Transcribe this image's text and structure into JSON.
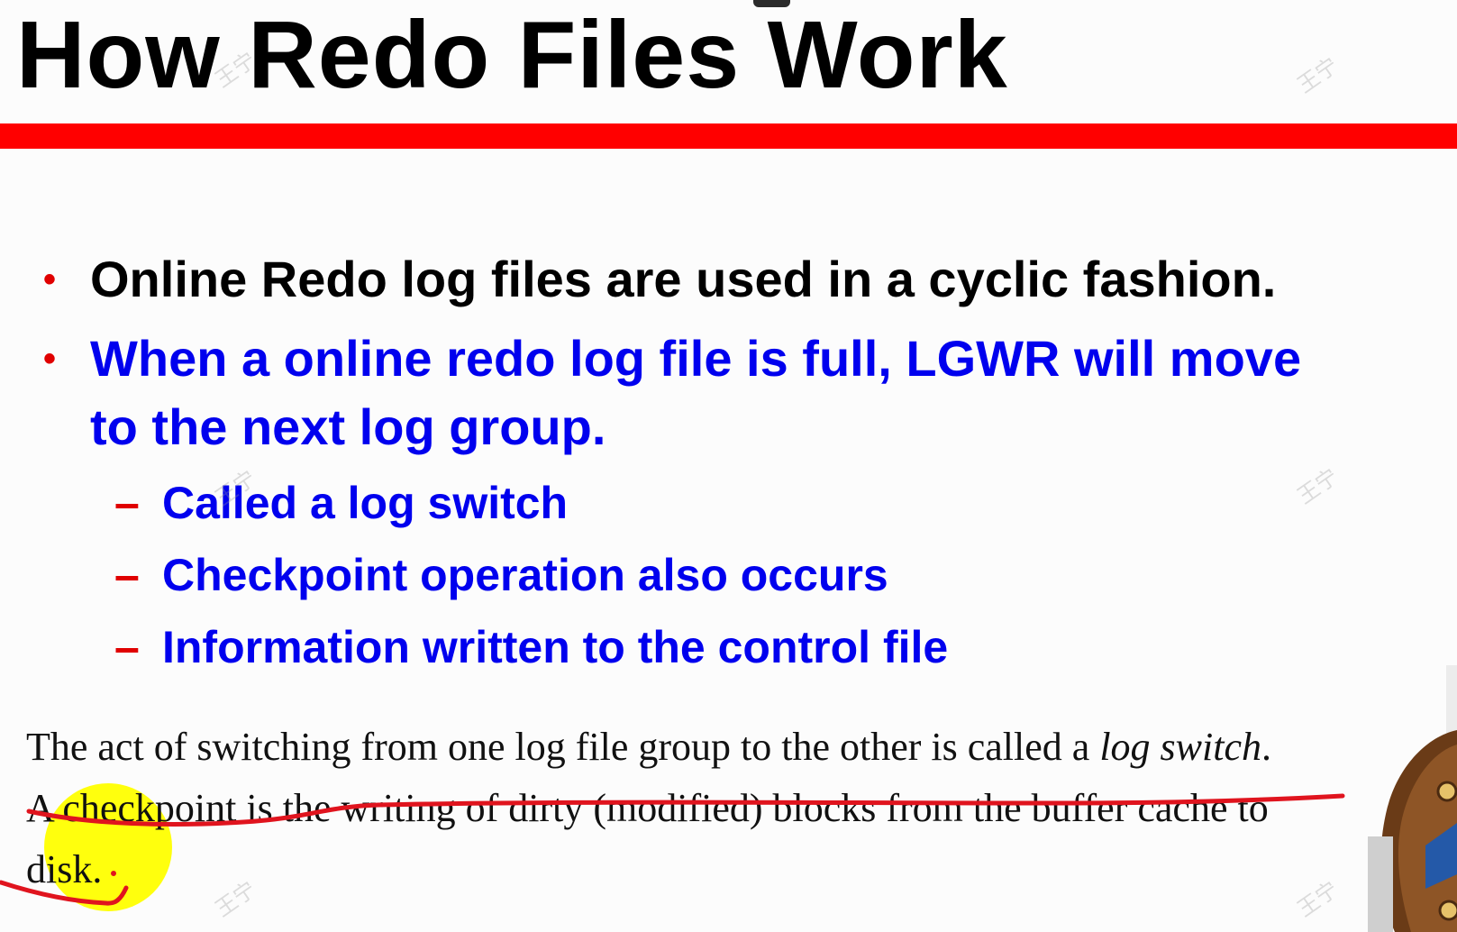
{
  "slide": {
    "title": "How Redo Files Work",
    "bullets": [
      {
        "dot": "•",
        "text": "Online Redo log files are used in a cyclic fashion."
      },
      {
        "dot": "•",
        "line1": "When a online redo log file is full, LGWR will move",
        "line2": "to the next log group."
      }
    ],
    "sub_bullets": [
      {
        "dash": "–",
        "text": "Called a log switch"
      },
      {
        "dash": "–",
        "text": "Checkpoint operation also occurs"
      },
      {
        "dash": "–",
        "text": "Information written to the control file"
      }
    ]
  },
  "note": {
    "line1_prefix": "The act of switching from one log file group to the other is called a ",
    "line1_italic": "log switch",
    "line1_suffix": ".",
    "line2": "A checkpoint is the writing of dirty (modified) blocks from the buffer cache to",
    "line3": "disk."
  },
  "annotations": {
    "underline_color": "#e0141e",
    "highlight_color": "#ffff00"
  },
  "watermark": {
    "text": "王宁"
  },
  "colors": {
    "title": "#000000",
    "rule": "#ff0000",
    "bullet_marker": "#e00000",
    "emphasis_blue": "#0000ee"
  }
}
